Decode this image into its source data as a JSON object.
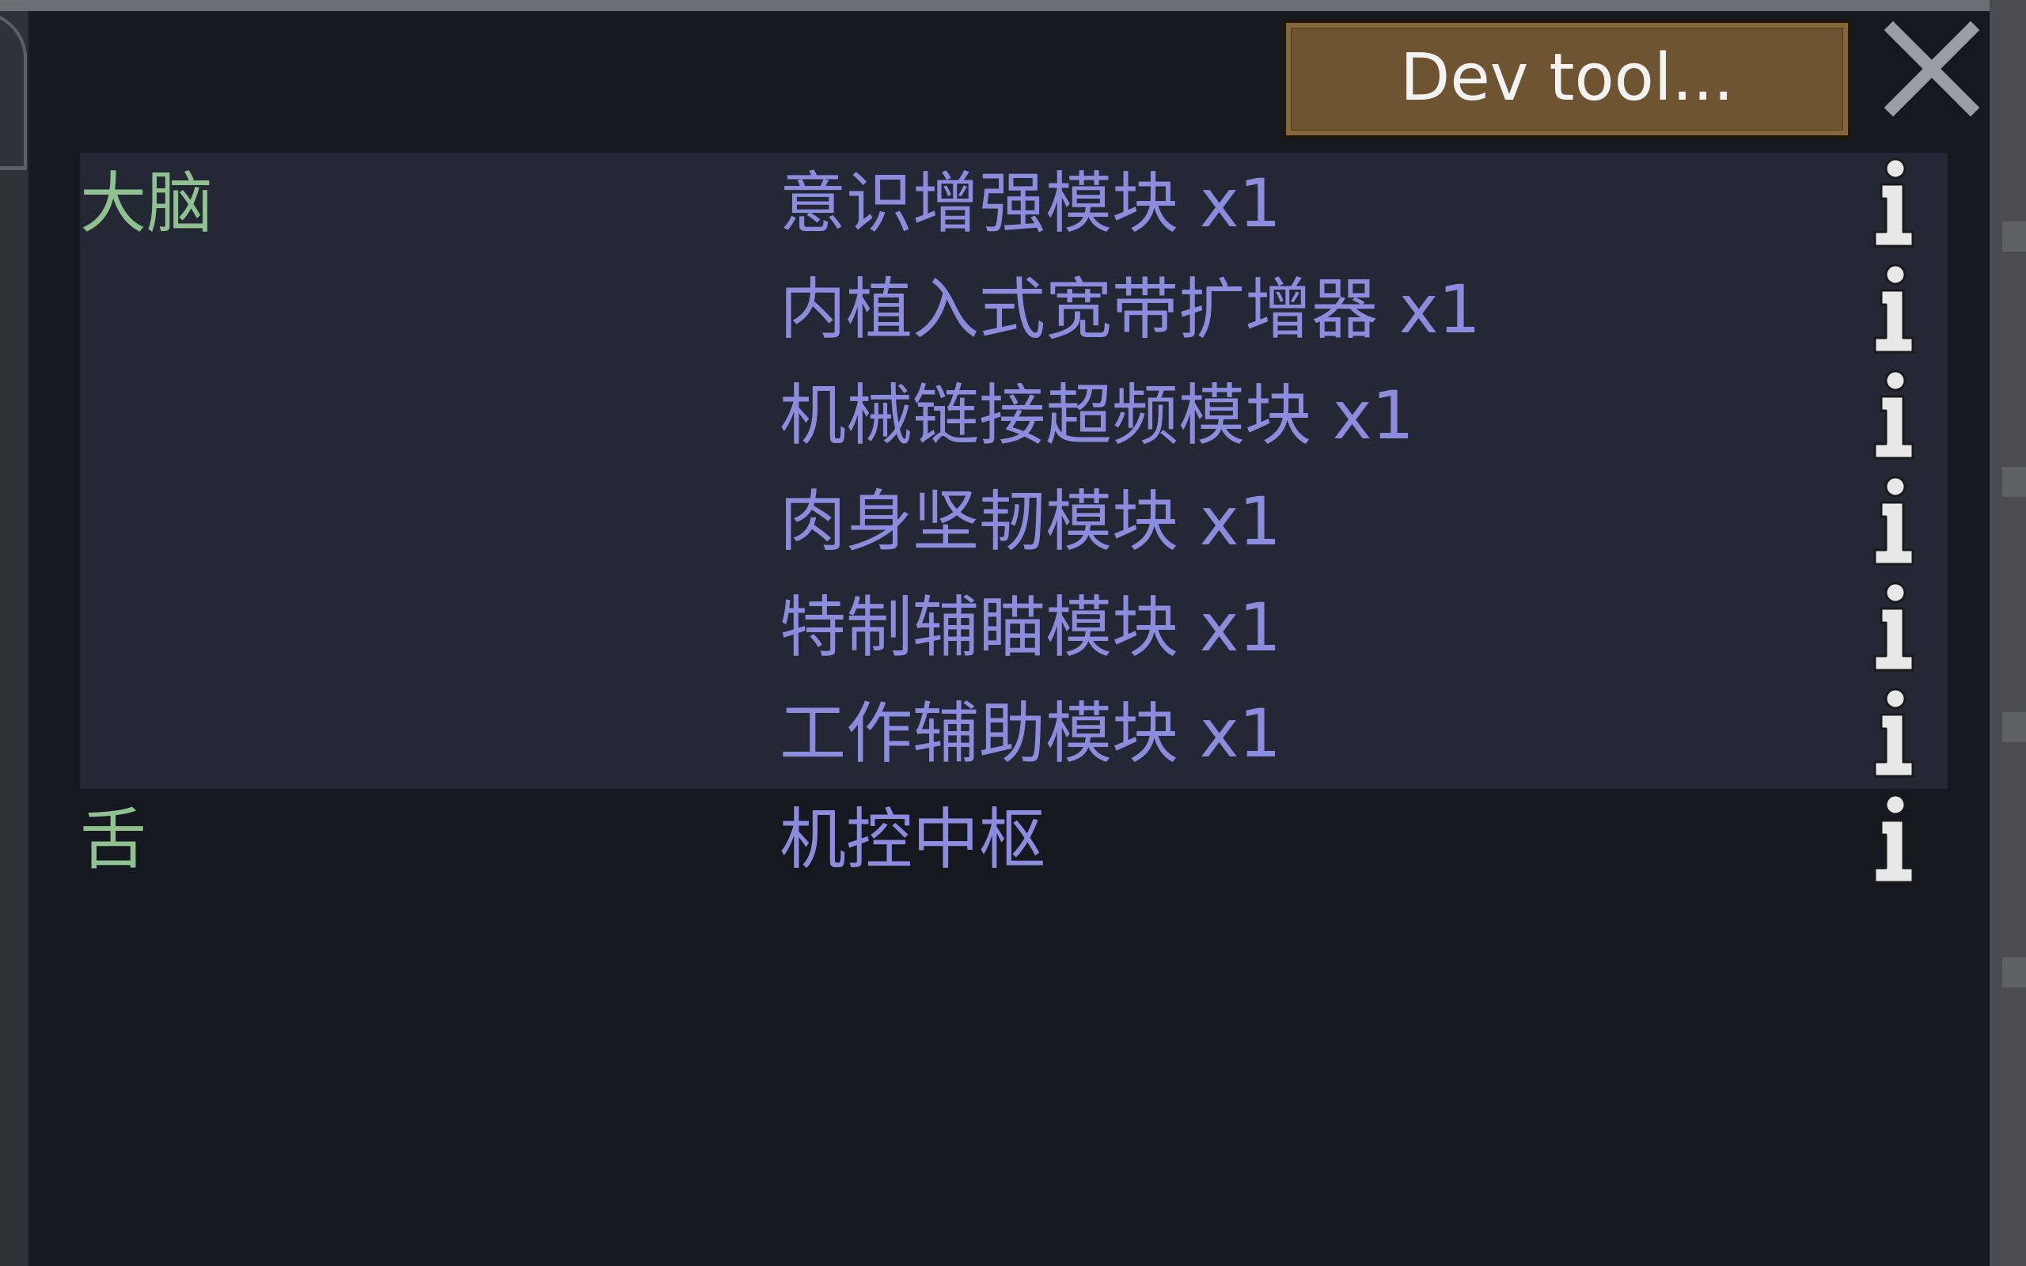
{
  "header": {
    "dev_tools_label": "Dev tool...",
    "close_icon": "close-icon"
  },
  "groups": [
    {
      "part": "大脑",
      "highlighted": true,
      "items": [
        {
          "label": "意识增强模块 x1",
          "icon": "info-icon"
        },
        {
          "label": "内植入式宽带扩增器 x1",
          "icon": "info-icon"
        },
        {
          "label": "机械链接超频模块 x1",
          "icon": "info-icon"
        },
        {
          "label": "肉身坚韧模块 x1",
          "icon": "info-icon"
        },
        {
          "label": "特制辅瞄模块 x1",
          "icon": "info-icon"
        },
        {
          "label": "工作辅助模块 x1",
          "icon": "info-icon"
        }
      ]
    },
    {
      "part": "舌",
      "highlighted": false,
      "items": [
        {
          "label": "机控中枢",
          "icon": "info-icon"
        }
      ]
    }
  ],
  "colors": {
    "part_label": "#8fc28f",
    "item_label": "#8b8cde",
    "highlight_bg": "#242834",
    "window_bg": "#15191f",
    "dev_button_bg": "#6e5430"
  }
}
